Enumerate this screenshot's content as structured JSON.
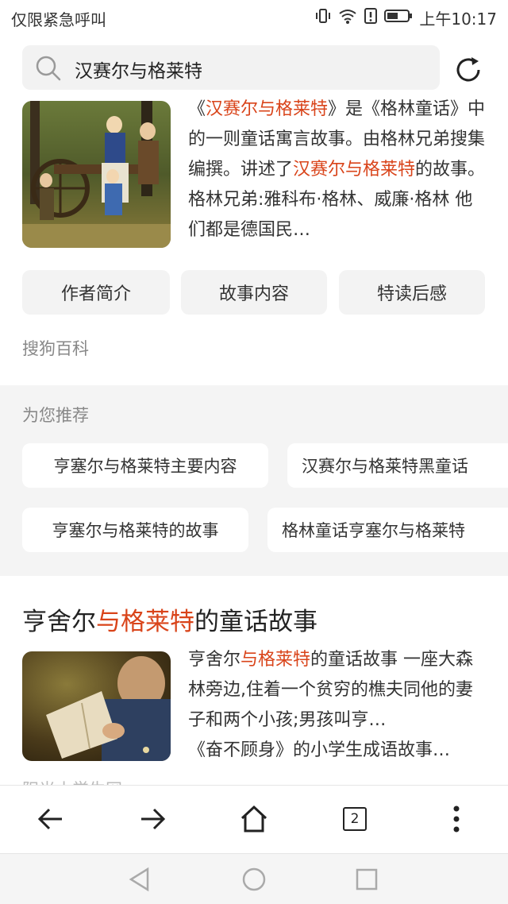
{
  "status_bar": {
    "carrier": "仅限紧急呼叫",
    "time": "上午10:17",
    "icons": [
      "vibrate-icon",
      "wifi-icon",
      "alert-icon",
      "battery-icon"
    ]
  },
  "search": {
    "query": "汉赛尔与格莱特"
  },
  "top_result": {
    "description_parts": [
      {
        "text": "《",
        "hl": false
      },
      {
        "text": "汉赛尔与格莱特",
        "hl": true
      },
      {
        "text": "》是《格林童话》中的一则童话寓言故事。由格林兄弟搜集编撰。讲述了",
        "hl": false
      },
      {
        "text": "汉赛尔与格莱特",
        "hl": true
      },
      {
        "text": "的故事。 格林兄弟:雅科布·格林、威廉·格林 他们都是德国民…",
        "hl": false
      }
    ],
    "chips": [
      "作者简介",
      "故事内容",
      "特读后感"
    ],
    "source": "搜狗百科"
  },
  "recommend": {
    "title": "为您推荐",
    "items": [
      "亨塞尔与格莱特主要内容",
      "汉赛尔与格莱特黑童话",
      "亨塞尔与格莱特的故事",
      "格林童话亨塞尔与格莱特"
    ]
  },
  "second_result": {
    "title_parts": [
      {
        "text": "亨舍尔",
        "hl": false
      },
      {
        "text": "与格莱特",
        "hl": true
      },
      {
        "text": "的童话故事",
        "hl": false
      }
    ],
    "description_parts": [
      {
        "text": "亨舍尔",
        "hl": false
      },
      {
        "text": "与格莱特",
        "hl": true
      },
      {
        "text": "的童话故事 一座大森林旁边,住着一个贫穷的樵夫同他的妻子和两个小孩;男孩叫亨…",
        "hl": false
      }
    ],
    "extra_line": "《奋不顾身》的小学生成语故事…",
    "faded_text": "阳光小学生网"
  },
  "bottom_nav": {
    "tab_count": "2"
  },
  "colors": {
    "highlight": "#d9441a",
    "chip_bg": "#f3f3f3",
    "section_bg": "#f4f4f4"
  }
}
